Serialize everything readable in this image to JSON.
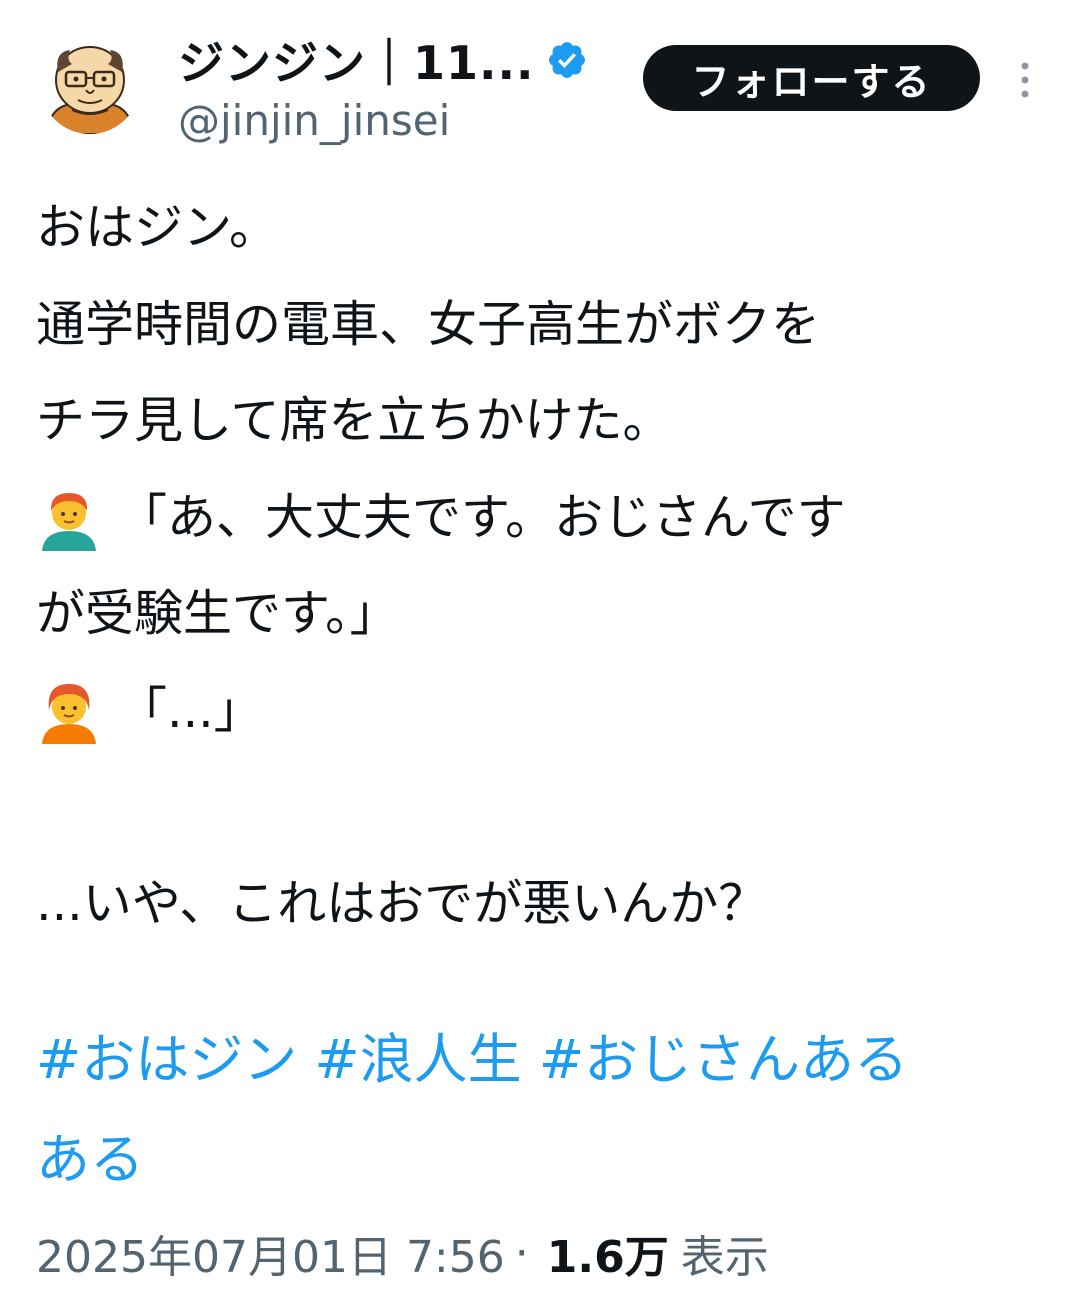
{
  "author": {
    "display_name": "ジンジン｜11...",
    "handle": "@jinjin_jinsei",
    "verified_badge_color": "#1d9bf0"
  },
  "actions": {
    "follow_label": "フォローする",
    "more_icon": "more-vertical-icon"
  },
  "tweet": {
    "lines": [
      "おはジン。",
      "通学時間の電車、女子高生がボクを",
      "チラ見して席を立ちかけた。",
      "「あ、大丈夫です。おじさんです",
      "が受験生です。」",
      "「...」",
      "",
      "...いや、これはおでが悪いんか？"
    ],
    "emojis": [
      "man-red-hair-emoji",
      "person-red-hair-emoji"
    ],
    "hashtags": [
      "#おはジン",
      "#浪人生",
      "#おじさんある",
      "ある"
    ]
  },
  "meta": {
    "timestamp": "2025年07月01日 7:56",
    "separator": "·",
    "views_count": "1.6万",
    "views_label": "表示"
  },
  "colors": {
    "link": "#1d9bf0",
    "text": "#0f1419",
    "secondary": "#536471",
    "button_bg": "#0f1419"
  }
}
